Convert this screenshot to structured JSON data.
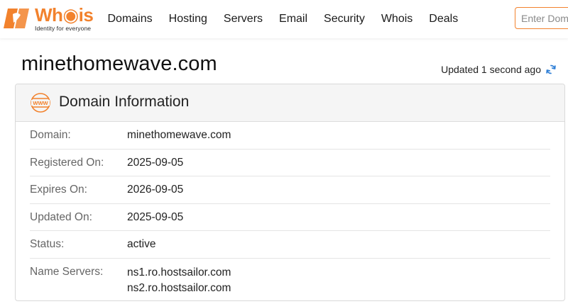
{
  "brand": {
    "name_main": "Wh",
    "name_accent": "is",
    "tagline": "Identity for everyone",
    "accent_color": "#f2822d"
  },
  "nav": {
    "items": [
      {
        "label": "Domains"
      },
      {
        "label": "Hosting"
      },
      {
        "label": "Servers"
      },
      {
        "label": "Email"
      },
      {
        "label": "Security"
      },
      {
        "label": "Whois"
      },
      {
        "label": "Deals"
      }
    ]
  },
  "search": {
    "placeholder": "Enter Domain",
    "value": ""
  },
  "page": {
    "title": "minethomewave.com",
    "updated_text": "Updated 1 second ago",
    "refresh_icon": "refresh-icon",
    "refresh_color": "#2f7fd6"
  },
  "card": {
    "icon": "www-icon",
    "title": "Domain Information",
    "rows": [
      {
        "label": "Domain:",
        "value": "minethomewave.com"
      },
      {
        "label": "Registered On:",
        "value": "2025-09-05"
      },
      {
        "label": "Expires On:",
        "value": "2026-09-05"
      },
      {
        "label": "Updated On:",
        "value": "2025-09-05"
      },
      {
        "label": "Status:",
        "value": "active"
      }
    ],
    "name_servers": {
      "label": "Name Servers:",
      "values": [
        "ns1.ro.hostsailor.com",
        "ns2.ro.hostsailor.com"
      ]
    }
  }
}
